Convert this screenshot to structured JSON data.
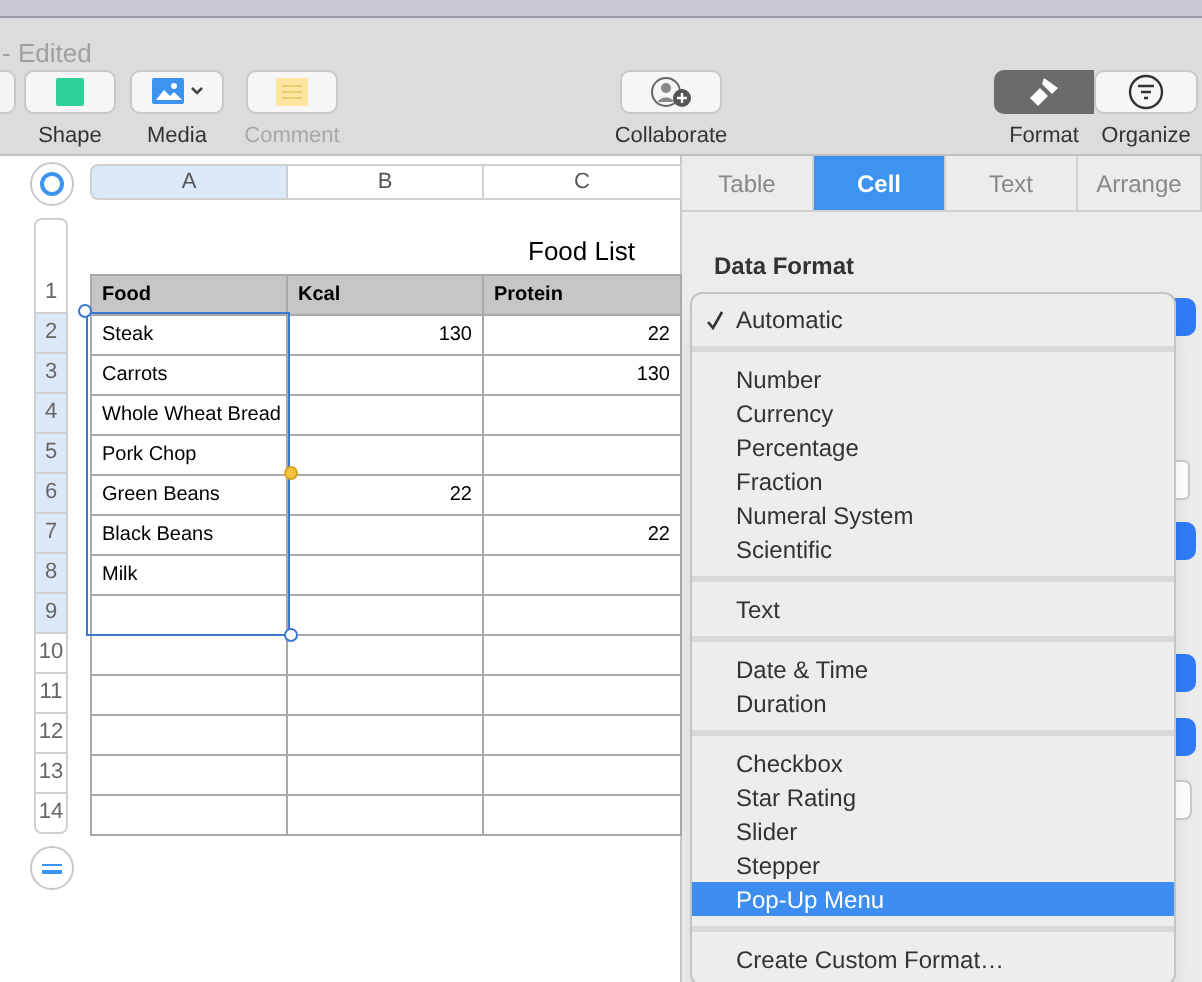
{
  "window": {
    "title": "- Edited"
  },
  "toolbar": [
    {
      "label": "Shape",
      "kind": "shape",
      "disabled": false,
      "selected": false
    },
    {
      "label": "Media",
      "kind": "media",
      "disabled": false,
      "selected": false
    },
    {
      "label": "Comment",
      "kind": "comment",
      "disabled": true,
      "selected": false
    },
    {
      "label": "Collaborate",
      "kind": "collaborate",
      "disabled": false,
      "selected": false
    },
    {
      "label": "Format",
      "kind": "format",
      "disabled": false,
      "selected": true
    },
    {
      "label": "Organize",
      "kind": "organize",
      "disabled": false,
      "selected": false
    }
  ],
  "table": {
    "title": "Food List",
    "columns": [
      {
        "label": "A",
        "selected": true
      },
      {
        "label": "B",
        "selected": false
      },
      {
        "label": "C",
        "selected": false
      }
    ],
    "rows": [
      {
        "number": "1",
        "selected": false,
        "cells": [
          "Food",
          "Kcal",
          "Protein"
        ]
      },
      {
        "number": "2",
        "selected": true,
        "cells": [
          "Steak",
          "130",
          "22"
        ]
      },
      {
        "number": "3",
        "selected": true,
        "cells": [
          "Carrots",
          "",
          "130"
        ]
      },
      {
        "number": "4",
        "selected": true,
        "cells": [
          "Whole Wheat Bread",
          "",
          ""
        ]
      },
      {
        "number": "5",
        "selected": true,
        "cells": [
          "Pork Chop",
          "",
          ""
        ]
      },
      {
        "number": "6",
        "selected": true,
        "cells": [
          "Green Beans",
          "22",
          ""
        ]
      },
      {
        "number": "7",
        "selected": true,
        "cells": [
          "Black Beans",
          "",
          "22"
        ]
      },
      {
        "number": "8",
        "selected": true,
        "cells": [
          "Milk",
          "",
          ""
        ]
      },
      {
        "number": "9",
        "selected": true,
        "cells": [
          "",
          "",
          ""
        ]
      },
      {
        "number": "10",
        "selected": false,
        "cells": [
          "",
          "",
          ""
        ]
      },
      {
        "number": "11",
        "selected": false,
        "cells": [
          "",
          "",
          ""
        ]
      },
      {
        "number": "12",
        "selected": false,
        "cells": [
          "",
          "",
          ""
        ]
      },
      {
        "number": "13",
        "selected": false,
        "cells": [
          "",
          "",
          ""
        ]
      },
      {
        "number": "14",
        "selected": false,
        "cells": [
          "",
          "",
          ""
        ]
      }
    ]
  },
  "inspector": {
    "tabs": [
      {
        "label": "Table",
        "selected": false
      },
      {
        "label": "Cell",
        "selected": true
      },
      {
        "label": "Text",
        "selected": false
      },
      {
        "label": "Arrange",
        "selected": false
      }
    ],
    "section_title": "Data Format",
    "menu": [
      [
        {
          "label": "Automatic",
          "checked": true,
          "selected": false
        }
      ],
      [
        {
          "label": "Number",
          "checked": false,
          "selected": false
        },
        {
          "label": "Currency",
          "checked": false,
          "selected": false
        },
        {
          "label": "Percentage",
          "checked": false,
          "selected": false
        },
        {
          "label": "Fraction",
          "checked": false,
          "selected": false
        },
        {
          "label": "Numeral System",
          "checked": false,
          "selected": false
        },
        {
          "label": "Scientific",
          "checked": false,
          "selected": false
        }
      ],
      [
        {
          "label": "Text",
          "checked": false,
          "selected": false
        }
      ],
      [
        {
          "label": "Date & Time",
          "checked": false,
          "selected": false
        },
        {
          "label": "Duration",
          "checked": false,
          "selected": false
        }
      ],
      [
        {
          "label": "Checkbox",
          "checked": false,
          "selected": false
        },
        {
          "label": "Star Rating",
          "checked": false,
          "selected": false
        },
        {
          "label": "Slider",
          "checked": false,
          "selected": false
        },
        {
          "label": "Stepper",
          "checked": false,
          "selected": false
        },
        {
          "label": "Pop-Up Menu",
          "checked": false,
          "selected": true
        }
      ],
      [
        {
          "label": "Create Custom Format…",
          "checked": false,
          "selected": false
        }
      ]
    ]
  }
}
